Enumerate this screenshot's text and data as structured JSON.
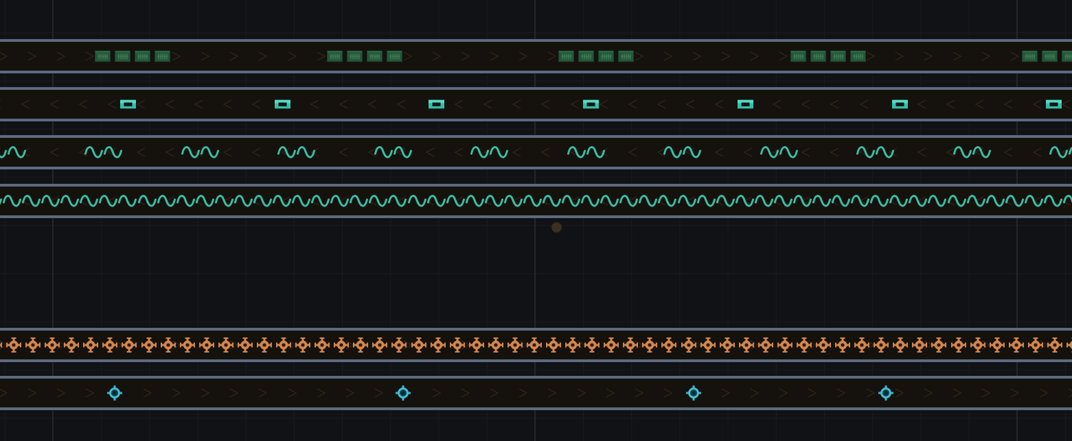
{
  "belts": [
    {
      "reversed": false,
      "kind": "crate"
    },
    {
      "reversed": true,
      "kind": "cell"
    },
    {
      "reversed": true,
      "kind": "wave-pair"
    },
    {
      "reversed": true,
      "kind": "wave"
    },
    {
      "reversed": false,
      "kind": "gear"
    },
    {
      "reversed": false,
      "kind": "ring"
    }
  ]
}
